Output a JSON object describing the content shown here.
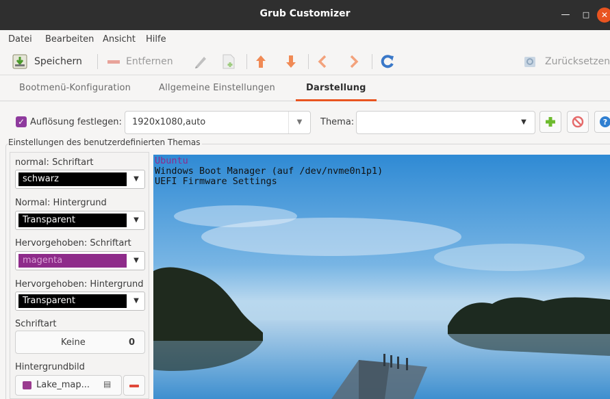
{
  "window": {
    "title": "Grub Customizer"
  },
  "menu": [
    "Datei",
    "Bearbeiten",
    "Ansicht",
    "Hilfe"
  ],
  "toolbar": {
    "save": "Speichern",
    "remove": "Entfernen",
    "reset": "Zurücksetzen"
  },
  "tabs": [
    "Bootmenü-Konfiguration",
    "Allgemeine Einstellungen",
    "Darstellung"
  ],
  "resolution": {
    "label": "Auflösung festlegen:",
    "value": "1920x1080,auto",
    "checked": true
  },
  "theme": {
    "label": "Thema:",
    "value": ""
  },
  "custom_theme": {
    "frame_label": "Einstellungen des benutzerdefinierten Themas",
    "normal_font_label": "normal: Schriftart",
    "normal_font_value": "schwarz",
    "normal_bg_label": "Normal: Hintergrund",
    "normal_bg_value": "Transparent",
    "highlight_font_label": "Hervorgehoben: Schriftart",
    "highlight_font_value": "magenta",
    "highlight_bg_label": "Hervorgehoben: Hintergrund",
    "highlight_bg_value": "Transparent",
    "font_label": "Schriftart",
    "font_name": "Keine",
    "font_size": "0",
    "bg_image_label": "Hintergrundbild",
    "bg_image_file": "Lake_map..."
  },
  "preview": {
    "entries": [
      "Ubuntu",
      "Windows Boot Manager (auf /dev/nvme0n1p1)",
      "UEFI Firmware Settings"
    ]
  },
  "colors": {
    "accent": "#e95420",
    "magenta": "#8e2b8a",
    "titlebar": "#2f2f2f"
  },
  "icons": [
    "save-icon",
    "remove-icon",
    "edit-icon",
    "new-entry-icon",
    "move-up-icon",
    "move-down-icon",
    "previous-icon",
    "next-icon",
    "refresh-icon",
    "revert-icon",
    "add-icon",
    "delete-icon",
    "help-icon",
    "image-file-icon",
    "document-icon"
  ]
}
